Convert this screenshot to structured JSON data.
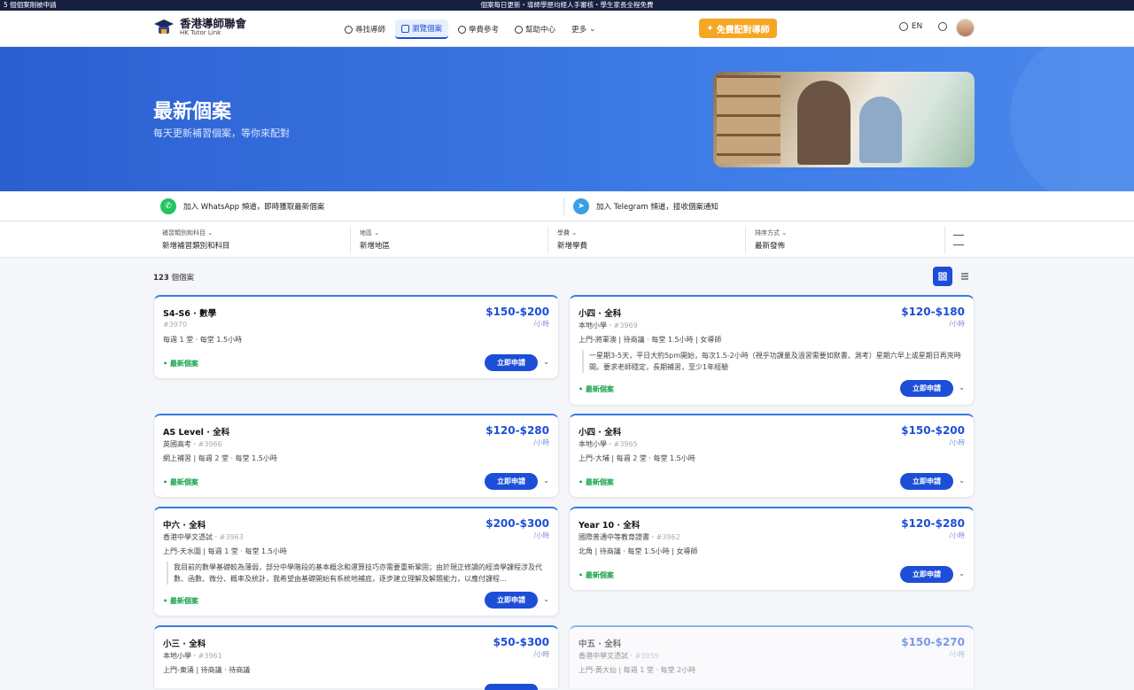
{
  "announce": {
    "left": "5 個個案剛被申請",
    "center": "個案每日更新・導師學歷均經人手審核・學生家長全程免費"
  },
  "brand": {
    "name": "香港導師聯會",
    "sub": "HK Tutor Link"
  },
  "nav": [
    {
      "label": "尋找導師",
      "active": false,
      "icon": "user-search-icon"
    },
    {
      "label": "瀏覽個案",
      "active": true,
      "icon": "clipboard-icon"
    },
    {
      "label": "學費參考",
      "active": false,
      "icon": "dollar-icon"
    },
    {
      "label": "幫助中心",
      "active": false,
      "icon": "help-icon"
    },
    {
      "label": "更多",
      "active": false,
      "icon": "chevron-down-icon"
    }
  ],
  "cta": "免費配對導師",
  "lang": "EN",
  "hero": {
    "title": "最新個案",
    "subtitle": "每天更新補習個案，等你來配對"
  },
  "channels": {
    "whatsapp": "加入 WhatsApp 頻道，即時獲取最新個案",
    "telegram": "加入 Telegram 頻道，接收個案通知"
  },
  "filters": [
    {
      "label": "補習類別和科目",
      "value": "新增補習類別和科目"
    },
    {
      "label": "地區",
      "value": "新增地區"
    },
    {
      "label": "學費",
      "value": "新增學費"
    },
    {
      "label": "排序方式",
      "value": "最新發佈"
    }
  ],
  "count": {
    "num": "123",
    "unit": "個個案"
  },
  "colors": {
    "primary": "#1d4ed8",
    "accent": "#f5a623",
    "new": "#16a34a"
  },
  "card_common": {
    "new": "最新個案",
    "apply": "立即申請",
    "unit": "/小時"
  },
  "cards": [
    {
      "title": "S4-S6 · 數學",
      "sub": "",
      "id": "#3970",
      "meta": "每週 1 堂 · 每堂 1.5小時",
      "price": "$150-$200",
      "desc": ""
    },
    {
      "title": "小四 · 全科",
      "sub": "本地小學 · ",
      "id": "#3969",
      "meta": "上門-將軍澳 | 待商議 · 每堂 1.5小時 | 女導師",
      "price": "$120-$180",
      "desc": "一星期3-5天，平日大約5pm開始，每次1.5-2小時（視乎功課量及溫習需要如默書、測考）星期六早上或星期日再夾時間。要求老師穩定，長期補習，至少1年經驗"
    },
    {
      "title": "AS Level · 全科",
      "sub": "英國高考 · ",
      "id": "#3966",
      "meta": "網上補習 | 每週 2 堂 · 每堂 1.5小時",
      "price": "$120-$280",
      "desc": ""
    },
    {
      "title": "小四 · 全科",
      "sub": "本地小學 · ",
      "id": "#3965",
      "meta": "上門-大埔 | 每週 2 堂 · 每堂 1.5小時",
      "price": "$150-$200",
      "desc": ""
    },
    {
      "title": "中六 · 全科",
      "sub": "香港中學文憑試 · ",
      "id": "#3963",
      "meta": "上門-天水圍 | 每週 1 堂 · 每堂 1.5小時",
      "price": "$200-$300",
      "desc": "我目前的數學基礎較為薄弱，部分中學階段的基本概念和運算技巧亦需要重新鞏固；由於現正修讀的經濟學課程涉及代數、函數、微分、概率及統計，我希望由基礎開始有系統地補底，逐步建立理解及解題能力，以應付課程..."
    },
    {
      "title": "Year 10 · 全科",
      "sub": "國際普通中等教育證書 · ",
      "id": "#3962",
      "meta": "北角 | 待商議 · 每堂 1.5小時 | 女導師",
      "price": "$120-$280",
      "desc": ""
    },
    {
      "title": "小三 · 全科",
      "sub": "本地小學 · ",
      "id": "#3961",
      "meta": "上門-東涌 | 待商議 · 待商議",
      "price": "$50-$300",
      "desc": ""
    },
    {
      "title": "中五 · 全科",
      "sub": "香港中學文憑試 · ",
      "id": "#3959",
      "meta": "上門-黃大仙 | 每週 1 堂 · 每堂 2小時",
      "price": "$150-$270",
      "desc": ""
    }
  ]
}
